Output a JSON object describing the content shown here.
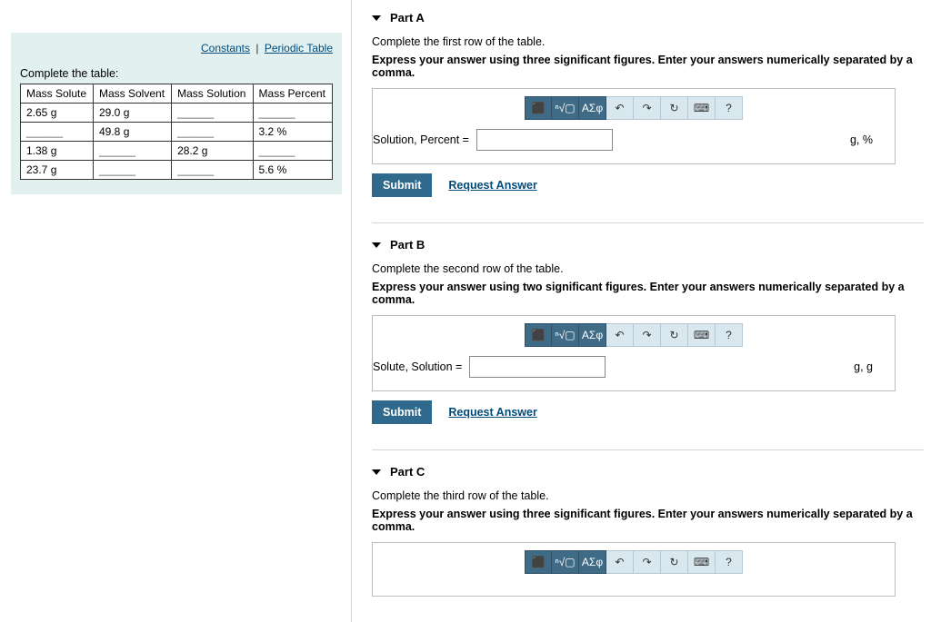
{
  "left": {
    "constants": "Constants",
    "periodic": "Periodic Table",
    "prompt": "Complete the table:",
    "headers": [
      "Mass Solute",
      "Mass Solvent",
      "Mass Solution",
      "Mass Percent"
    ],
    "rows": [
      [
        "2.65 g",
        "29.0 g",
        "______",
        "______"
      ],
      [
        "______",
        "49.8 g",
        "______",
        "3.2 %"
      ],
      [
        "1.38 g",
        "______",
        "28.2 g",
        "______"
      ],
      [
        "23.7 g",
        "______",
        "______",
        "5.6 %"
      ]
    ]
  },
  "parts": {
    "a": {
      "title": "Part A",
      "instr": "Complete the first row of the table.",
      "hint": "Express your answer using three significant figures. Enter your answers numerically separated by a comma.",
      "label": "Solution, Percent =",
      "units": "g, %"
    },
    "b": {
      "title": "Part B",
      "instr": "Complete the second row of the table.",
      "hint": "Express your answer using two significant figures. Enter your answers numerically separated by a comma.",
      "label": "Solute, Solution =",
      "units": "g, g"
    },
    "c": {
      "title": "Part C",
      "instr": "Complete the third row of the table.",
      "hint": "Express your answer using three significant figures. Enter your answers numerically separated by a comma."
    }
  },
  "toolbar": {
    "templates": "⬛",
    "xroot": "ⁿ√▢",
    "greek": "ΑΣφ",
    "undo": "↶",
    "redo": "↷",
    "reset": "↻",
    "keyboard": "⌨",
    "help": "?"
  },
  "buttons": {
    "submit": "Submit",
    "request": "Request Answer"
  }
}
